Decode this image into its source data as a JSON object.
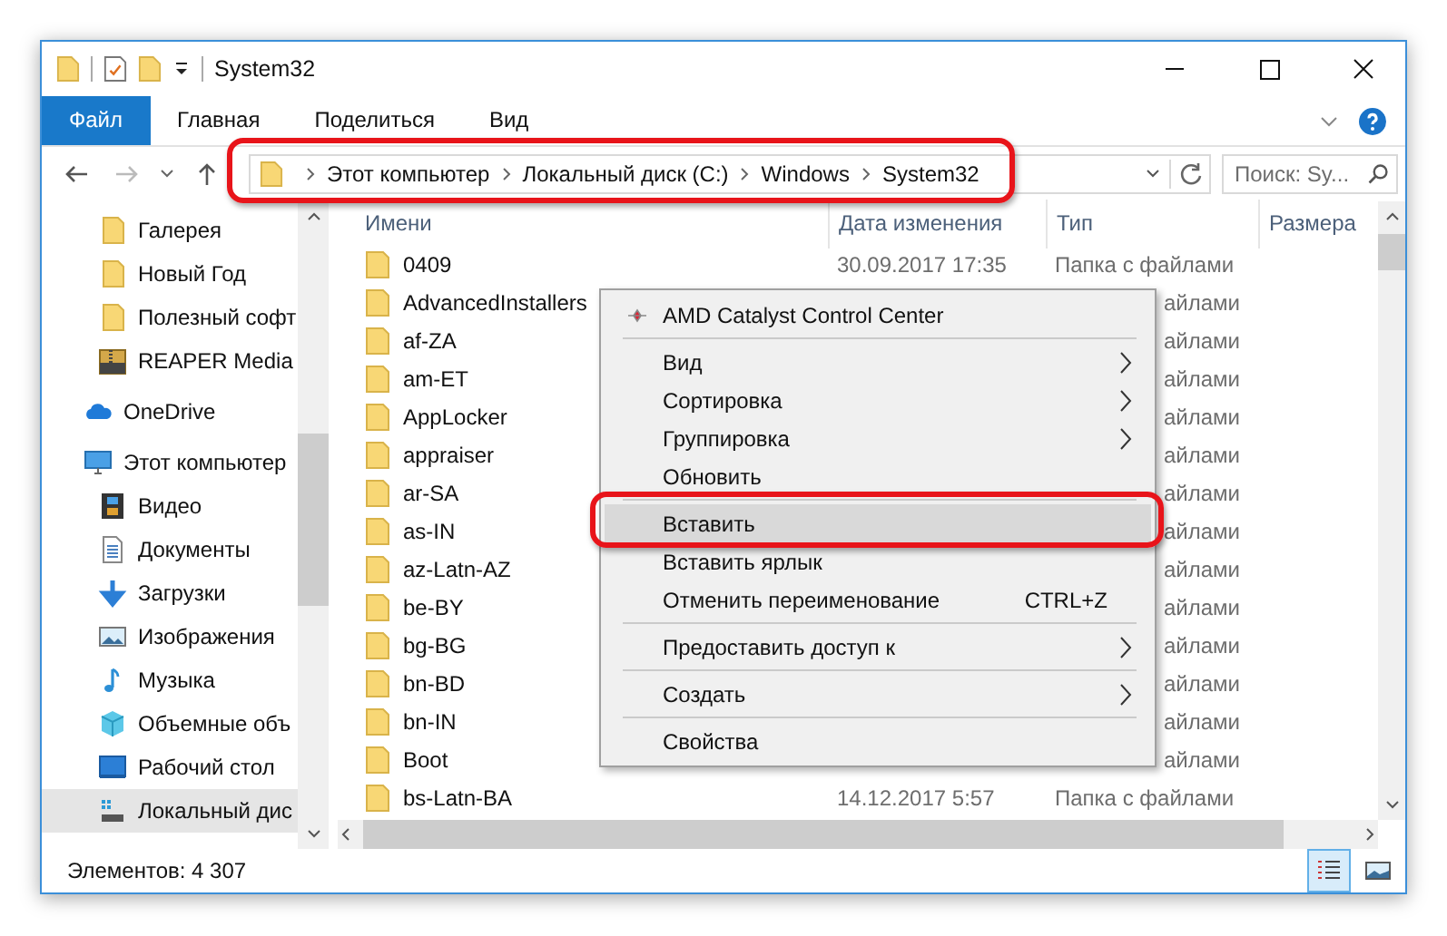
{
  "window": {
    "title": "System32"
  },
  "ribbon_tabs": [
    {
      "label": "Файл",
      "kind": "file"
    },
    {
      "label": "Главная",
      "kind": "tab"
    },
    {
      "label": "Поделиться",
      "kind": "tab"
    },
    {
      "label": "Вид",
      "kind": "tab"
    }
  ],
  "address": {
    "crumbs": [
      "Этот компьютер",
      "Локальный диск (C:)",
      "Windows",
      "System32"
    ]
  },
  "search": {
    "placeholder": "Поиск: Sy..."
  },
  "quick_access": [
    {
      "label": "Галерея",
      "kind": "folder"
    },
    {
      "label": "Новый Год",
      "kind": "folder"
    },
    {
      "label": "Полезный софт",
      "kind": "folder"
    },
    {
      "label": "REAPER Media",
      "kind": "zip"
    }
  ],
  "nav_roots": [
    {
      "label": "OneDrive",
      "kind": "cloud",
      "selected": false
    },
    {
      "label": "Этот компьютер",
      "kind": "pc",
      "selected": false,
      "children": [
        {
          "label": "Видео",
          "kind": "video",
          "selected": false
        },
        {
          "label": "Документы",
          "kind": "docs",
          "selected": false
        },
        {
          "label": "Загрузки",
          "kind": "download",
          "selected": false
        },
        {
          "label": "Изображения",
          "kind": "pictures",
          "selected": false
        },
        {
          "label": "Музыка",
          "kind": "music",
          "selected": false
        },
        {
          "label": "Объемные объ",
          "kind": "cube",
          "selected": false
        },
        {
          "label": "Рабочий стол",
          "kind": "desktop",
          "selected": false
        },
        {
          "label": "Локальный дис",
          "kind": "drive",
          "selected": true
        }
      ]
    }
  ],
  "columns": [
    "Имени",
    "Дата изменения",
    "Тип",
    "Размера"
  ],
  "rows": [
    {
      "name": "0409",
      "date": "30.09.2017 17:35",
      "type": "Папка с файлами"
    },
    {
      "name": "AdvancedInstallers",
      "type_tail": "айлами"
    },
    {
      "name": "af-ZA",
      "type_tail": "айлами"
    },
    {
      "name": "am-ET",
      "type_tail": "айлами"
    },
    {
      "name": "AppLocker",
      "type_tail": "айлами"
    },
    {
      "name": "appraiser",
      "type_tail": "айлами"
    },
    {
      "name": "ar-SA",
      "type_tail": "айлами"
    },
    {
      "name": "as-IN",
      "type_tail": "айлами"
    },
    {
      "name": "az-Latn-AZ",
      "type_tail": "айлами"
    },
    {
      "name": "be-BY",
      "type_tail": "айлами"
    },
    {
      "name": "bg-BG",
      "type_tail": "айлами"
    },
    {
      "name": "bn-BD",
      "type_tail": "айлами"
    },
    {
      "name": "bn-IN",
      "type_tail": "айлами"
    },
    {
      "name": "Boot",
      "type_tail": "айлами"
    },
    {
      "name": "bs-Latn-BA",
      "date": "14.12.2017 5:57",
      "type": "Папка с файлами"
    }
  ],
  "context_menu": [
    {
      "kind": "app",
      "label": "AMD Catalyst Control Center"
    },
    {
      "kind": "separator"
    },
    {
      "kind": "item",
      "label": "Вид",
      "submenu": true,
      "selected": false
    },
    {
      "kind": "item",
      "label": "Сортировка",
      "submenu": true,
      "selected": false
    },
    {
      "kind": "item",
      "label": "Группировка",
      "submenu": true,
      "selected": false
    },
    {
      "kind": "item",
      "label": "Обновить",
      "submenu": false,
      "selected": false
    },
    {
      "kind": "separator"
    },
    {
      "kind": "item",
      "label": "Вставить",
      "submenu": false,
      "selected": true
    },
    {
      "kind": "item",
      "label": "Вставить ярлык",
      "submenu": false,
      "selected": false
    },
    {
      "kind": "item",
      "label": "Отменить переименование",
      "shortcut": "CTRL+Z",
      "submenu": false,
      "selected": false
    },
    {
      "kind": "separator"
    },
    {
      "kind": "item",
      "label": "Предоставить доступ к",
      "submenu": true,
      "selected": false
    },
    {
      "kind": "separator"
    },
    {
      "kind": "item",
      "label": "Создать",
      "submenu": true,
      "selected": false
    },
    {
      "kind": "separator"
    },
    {
      "kind": "item",
      "label": "Свойства",
      "submenu": false,
      "selected": false
    }
  ],
  "status_bar": {
    "text": "Элементов: 4 307"
  },
  "view_buttons": [
    {
      "kind": "details",
      "selected": true
    },
    {
      "kind": "thumbnails",
      "selected": false
    }
  ]
}
